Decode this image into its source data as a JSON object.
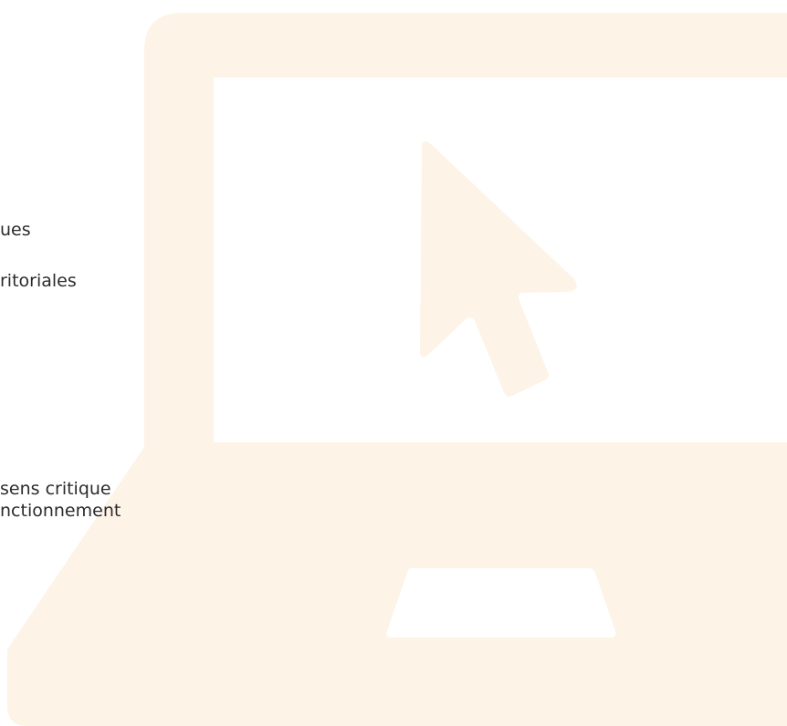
{
  "text_lines": [
    "ues",
    "ritoriales",
    "sens critique",
    "nctionnement"
  ],
  "illustration": {
    "laptop_color": "#fdf3e7",
    "screen_color": "#ffffff",
    "cursor_color": "#fdf3e7",
    "trackpad_color": "#ffffff"
  }
}
